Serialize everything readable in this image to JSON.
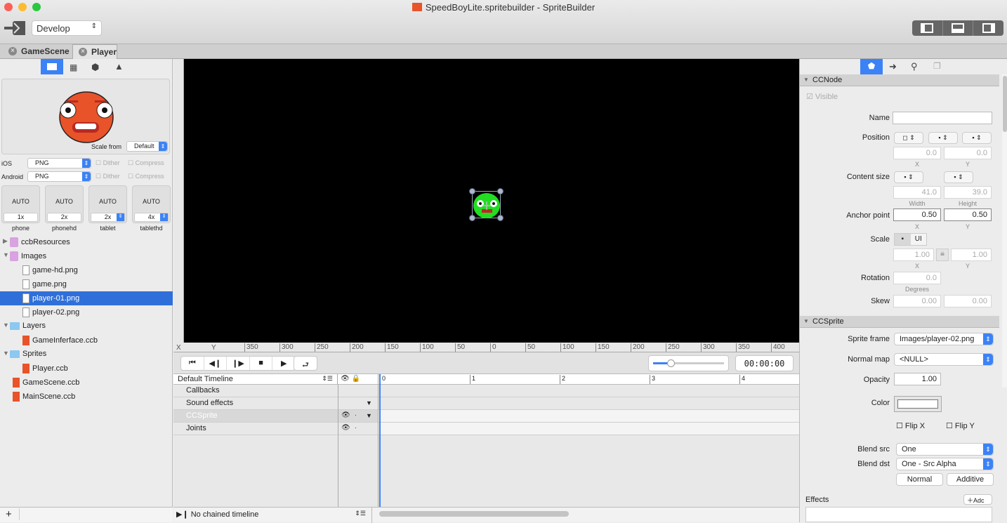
{
  "window": {
    "title": "SpeedBoyLite.spritebuilder - SpriteBuilder",
    "scheme": "Develop"
  },
  "tabs": [
    {
      "label": "GameScene"
    },
    {
      "label": "Player"
    }
  ],
  "left": {
    "scale_from_label": "Scale from",
    "scale_from": "Default",
    "ios": {
      "label": "iOS",
      "format": "PNG",
      "dither": "Dither",
      "compress": "Compress"
    },
    "android": {
      "label": "Android",
      "format": "PNG",
      "dither": "Dither",
      "compress": "Compress"
    },
    "resolutions": [
      {
        "auto": "AUTO",
        "scale": "1x",
        "name": "phone"
      },
      {
        "auto": "AUTO",
        "scale": "2x",
        "name": "phonehd"
      },
      {
        "auto": "AUTO",
        "scale": "2x",
        "name": "tablet"
      },
      {
        "auto": "AUTO",
        "scale": "4x",
        "name": "tablethd"
      }
    ],
    "tree": [
      {
        "label": "ccbResources",
        "type": "smart-folder",
        "depth": 0,
        "disclosure": "collapsed"
      },
      {
        "label": "Images",
        "type": "smart-folder",
        "depth": 0,
        "disclosure": "expanded"
      },
      {
        "label": "game-hd.png",
        "type": "image",
        "depth": 1
      },
      {
        "label": "game.png",
        "type": "image",
        "depth": 1
      },
      {
        "label": "player-01.png",
        "type": "image",
        "depth": 1,
        "selected": true
      },
      {
        "label": "player-02.png",
        "type": "image",
        "depth": 1
      },
      {
        "label": "Layers",
        "type": "folder",
        "depth": 0,
        "disclosure": "expanded"
      },
      {
        "label": "GameInferface.ccb",
        "type": "ccb",
        "depth": 1
      },
      {
        "label": "Sprites",
        "type": "folder",
        "depth": 0,
        "disclosure": "expanded"
      },
      {
        "label": "Player.ccb",
        "type": "ccb",
        "depth": 1
      },
      {
        "label": "GameScene.ccb",
        "type": "ccb",
        "depth": 0
      },
      {
        "label": "MainScene.ccb",
        "type": "ccb",
        "depth": 0
      }
    ],
    "add": "+"
  },
  "ruler": {
    "x": "X",
    "y": "Y",
    "ticks": [
      "350",
      "300",
      "250",
      "200",
      "150",
      "100",
      "50",
      "0",
      "50",
      "100",
      "150",
      "200",
      "250",
      "300",
      "350",
      "400"
    ]
  },
  "timeline": {
    "time": "00:00:00",
    "zoom_fraction": 0.25,
    "name": "Default Timeline",
    "scale": [
      "0",
      "1",
      "2",
      "3",
      "4"
    ],
    "rows": [
      "Callbacks",
      "Sound effects",
      "CCSprite",
      "Joints"
    ],
    "chained": "No chained timeline"
  },
  "inspector": {
    "ccnode": {
      "title": "CCNode",
      "visible": "Visible",
      "name_label": "Name",
      "name_value": "",
      "position_label": "Position",
      "pos_x": "0.0",
      "pos_y": "0.0",
      "x": "X",
      "y": "Y",
      "content_label": "Content size",
      "width": "41.0",
      "height": "39.0",
      "width_label": "Width",
      "height_label": "Height",
      "anchor_label": "Anchor point",
      "anchor_x": "0.50",
      "anchor_y": "0.50",
      "scale_label": "Scale",
      "scale_ui": "UI",
      "scale_x": "1.00",
      "scale_y": "1.00",
      "rotation_label": "Rotation",
      "rotation": "0.0",
      "degrees": "Degrees",
      "skew_label": "Skew",
      "skew_x": "0.00",
      "skew_y": "0.00"
    },
    "ccsprite": {
      "title": "CCSprite",
      "frame_label": "Sprite frame",
      "frame": "Images/player-02.png",
      "normal_label": "Normal map",
      "normal": "<NULL>",
      "opacity_label": "Opacity",
      "opacity": "1.00",
      "color_label": "Color",
      "color": "#ffffff",
      "flipx": "Flip X",
      "flipy": "Flip Y",
      "blend_src_label": "Blend src",
      "blend_src": "One",
      "blend_dst_label": "Blend dst",
      "blend_dst": "One - Src Alpha",
      "normal_btn": "Normal",
      "additive_btn": "Additive"
    },
    "effects": {
      "title": "Effects",
      "add": "Adc"
    }
  },
  "colors": {
    "accent": "#3b82f6",
    "selection": "#2f6fd9",
    "sprite": "#22dd22",
    "character": "#e8532a"
  }
}
